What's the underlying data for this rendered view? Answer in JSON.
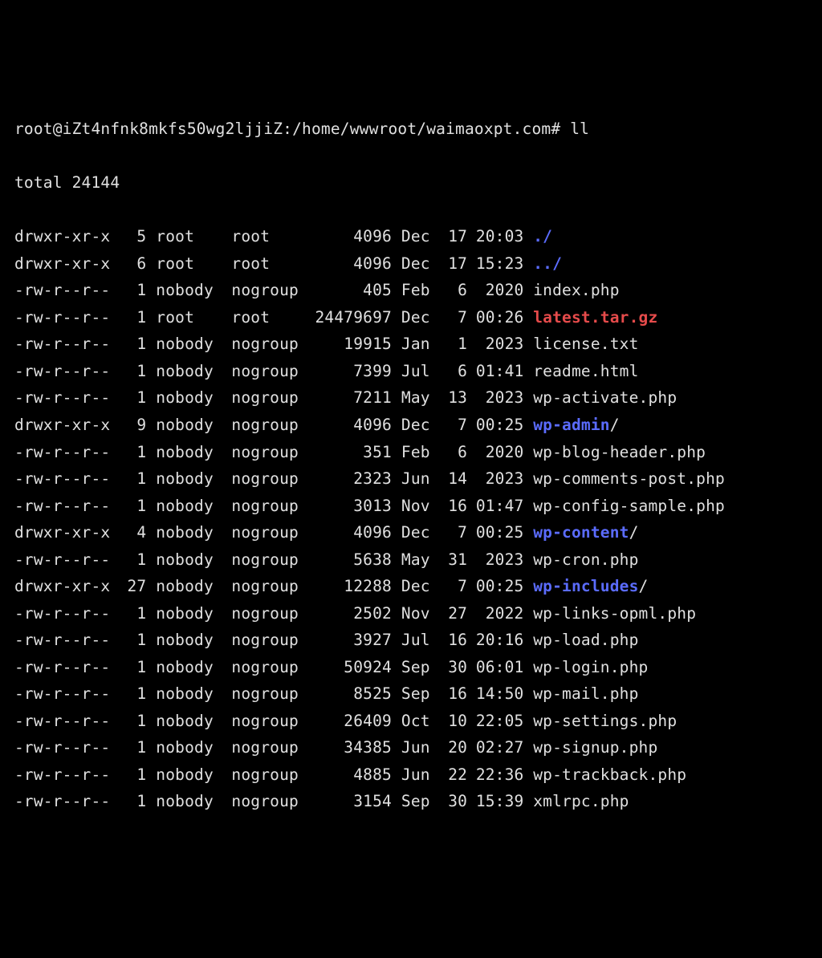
{
  "prompt": {
    "user_host_path": "root@iZt4nfnk8mkfs50wg2ljjiZ:/home/wwwroot/waimaoxpt.com#",
    "command": "ll"
  },
  "total_line": "total 24144",
  "colors": {
    "directory": "#5b6cff",
    "archive": "#e64b4b",
    "normal": "#e0e0e0"
  },
  "entries": [
    {
      "perms": "drwxr-xr-x",
      "links": "5",
      "owner": "root",
      "group": "root",
      "size": "4096",
      "month": "Dec",
      "day": "17",
      "time": "20:03",
      "name": "./",
      "type": "dir",
      "suffix": ""
    },
    {
      "perms": "drwxr-xr-x",
      "links": "6",
      "owner": "root",
      "group": "root",
      "size": "4096",
      "month": "Dec",
      "day": "17",
      "time": "15:23",
      "name": "../",
      "type": "dir",
      "suffix": ""
    },
    {
      "perms": "-rw-r--r--",
      "links": "1",
      "owner": "nobody",
      "group": "nogroup",
      "size": "405",
      "month": "Feb",
      "day": "6",
      "time": "2020",
      "name": "index.php",
      "type": "normal",
      "suffix": ""
    },
    {
      "perms": "-rw-r--r--",
      "links": "1",
      "owner": "root",
      "group": "root",
      "size": "24479697",
      "month": "Dec",
      "day": "7",
      "time": "00:26",
      "name": "latest.tar.gz",
      "type": "arch",
      "suffix": ""
    },
    {
      "perms": "-rw-r--r--",
      "links": "1",
      "owner": "nobody",
      "group": "nogroup",
      "size": "19915",
      "month": "Jan",
      "day": "1",
      "time": "2023",
      "name": "license.txt",
      "type": "normal",
      "suffix": ""
    },
    {
      "perms": "-rw-r--r--",
      "links": "1",
      "owner": "nobody",
      "group": "nogroup",
      "size": "7399",
      "month": "Jul",
      "day": "6",
      "time": "01:41",
      "name": "readme.html",
      "type": "normal",
      "suffix": ""
    },
    {
      "perms": "-rw-r--r--",
      "links": "1",
      "owner": "nobody",
      "group": "nogroup",
      "size": "7211",
      "month": "May",
      "day": "13",
      "time": "2023",
      "name": "wp-activate.php",
      "type": "normal",
      "suffix": ""
    },
    {
      "perms": "drwxr-xr-x",
      "links": "9",
      "owner": "nobody",
      "group": "nogroup",
      "size": "4096",
      "month": "Dec",
      "day": "7",
      "time": "00:25",
      "name": "wp-admin",
      "type": "dir",
      "suffix": "/"
    },
    {
      "perms": "-rw-r--r--",
      "links": "1",
      "owner": "nobody",
      "group": "nogroup",
      "size": "351",
      "month": "Feb",
      "day": "6",
      "time": "2020",
      "name": "wp-blog-header.php",
      "type": "normal",
      "suffix": ""
    },
    {
      "perms": "-rw-r--r--",
      "links": "1",
      "owner": "nobody",
      "group": "nogroup",
      "size": "2323",
      "month": "Jun",
      "day": "14",
      "time": "2023",
      "name": "wp-comments-post.php",
      "type": "normal",
      "suffix": ""
    },
    {
      "perms": "-rw-r--r--",
      "links": "1",
      "owner": "nobody",
      "group": "nogroup",
      "size": "3013",
      "month": "Nov",
      "day": "16",
      "time": "01:47",
      "name": "wp-config-sample.php",
      "type": "normal",
      "suffix": ""
    },
    {
      "perms": "drwxr-xr-x",
      "links": "4",
      "owner": "nobody",
      "group": "nogroup",
      "size": "4096",
      "month": "Dec",
      "day": "7",
      "time": "00:25",
      "name": "wp-content",
      "type": "dir",
      "suffix": "/"
    },
    {
      "perms": "-rw-r--r--",
      "links": "1",
      "owner": "nobody",
      "group": "nogroup",
      "size": "5638",
      "month": "May",
      "day": "31",
      "time": "2023",
      "name": "wp-cron.php",
      "type": "normal",
      "suffix": ""
    },
    {
      "perms": "drwxr-xr-x",
      "links": "27",
      "owner": "nobody",
      "group": "nogroup",
      "size": "12288",
      "month": "Dec",
      "day": "7",
      "time": "00:25",
      "name": "wp-includes",
      "type": "dir",
      "suffix": "/"
    },
    {
      "perms": "-rw-r--r--",
      "links": "1",
      "owner": "nobody",
      "group": "nogroup",
      "size": "2502",
      "month": "Nov",
      "day": "27",
      "time": "2022",
      "name": "wp-links-opml.php",
      "type": "normal",
      "suffix": ""
    },
    {
      "perms": "-rw-r--r--",
      "links": "1",
      "owner": "nobody",
      "group": "nogroup",
      "size": "3927",
      "month": "Jul",
      "day": "16",
      "time": "20:16",
      "name": "wp-load.php",
      "type": "normal",
      "suffix": ""
    },
    {
      "perms": "-rw-r--r--",
      "links": "1",
      "owner": "nobody",
      "group": "nogroup",
      "size": "50924",
      "month": "Sep",
      "day": "30",
      "time": "06:01",
      "name": "wp-login.php",
      "type": "normal",
      "suffix": ""
    },
    {
      "perms": "-rw-r--r--",
      "links": "1",
      "owner": "nobody",
      "group": "nogroup",
      "size": "8525",
      "month": "Sep",
      "day": "16",
      "time": "14:50",
      "name": "wp-mail.php",
      "type": "normal",
      "suffix": ""
    },
    {
      "perms": "-rw-r--r--",
      "links": "1",
      "owner": "nobody",
      "group": "nogroup",
      "size": "26409",
      "month": "Oct",
      "day": "10",
      "time": "22:05",
      "name": "wp-settings.php",
      "type": "normal",
      "suffix": ""
    },
    {
      "perms": "-rw-r--r--",
      "links": "1",
      "owner": "nobody",
      "group": "nogroup",
      "size": "34385",
      "month": "Jun",
      "day": "20",
      "time": "02:27",
      "name": "wp-signup.php",
      "type": "normal",
      "suffix": ""
    },
    {
      "perms": "-rw-r--r--",
      "links": "1",
      "owner": "nobody",
      "group": "nogroup",
      "size": "4885",
      "month": "Jun",
      "day": "22",
      "time": "22:36",
      "name": "wp-trackback.php",
      "type": "normal",
      "suffix": ""
    },
    {
      "perms": "-rw-r--r--",
      "links": "1",
      "owner": "nobody",
      "group": "nogroup",
      "size": "3154",
      "month": "Sep",
      "day": "30",
      "time": "15:39",
      "name": "xmlrpc.php",
      "type": "normal",
      "suffix": ""
    }
  ]
}
